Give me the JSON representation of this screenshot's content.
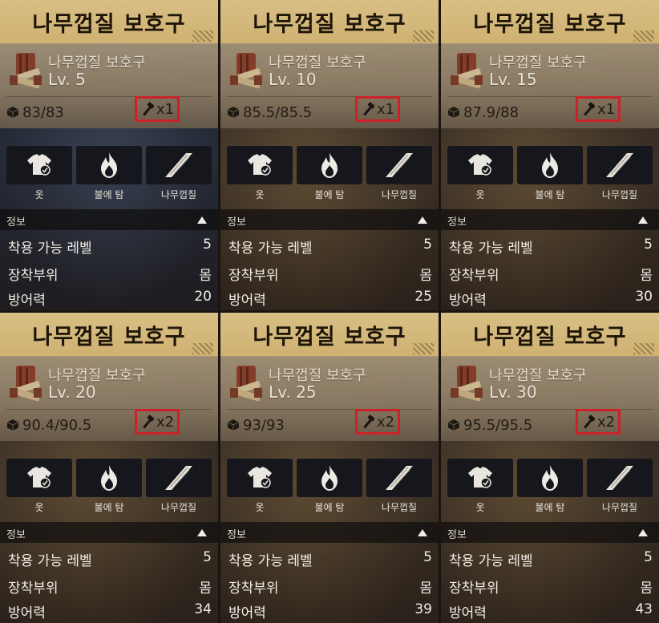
{
  "cards": [
    {
      "title": "나무껍질 보호구",
      "name": "나무껍질 보호구",
      "level": "Lv. 5",
      "durability": "83/83",
      "hammer": "x1",
      "tone": "blue",
      "buttons": [
        "옷",
        "불에 탐",
        "나무껍질"
      ],
      "section": "정보",
      "stats": [
        {
          "label": "착용 가능 레벨",
          "value": "5"
        },
        {
          "label": "장착부위",
          "value": "몸"
        },
        {
          "label": "방어력",
          "value": "20"
        }
      ]
    },
    {
      "title": "나무껍질 보호구",
      "name": "나무껍질 보호구",
      "level": "Lv. 10",
      "durability": "85.5/85.5",
      "hammer": "x1",
      "tone": "brown",
      "buttons": [
        "옷",
        "불에 탐",
        "나무껍질"
      ],
      "section": "정보",
      "stats": [
        {
          "label": "착용 가능 레벨",
          "value": "5"
        },
        {
          "label": "장착부위",
          "value": "몸"
        },
        {
          "label": "방어력",
          "value": "25"
        }
      ]
    },
    {
      "title": "나무껍질 보호구",
      "name": "나무껍질 보호구",
      "level": "Lv. 15",
      "durability": "87.9/88",
      "hammer": "x1",
      "tone": "brown",
      "buttons": [
        "옷",
        "불에 탐",
        "나무껍질"
      ],
      "section": "정보",
      "stats": [
        {
          "label": "착용 가능 레벨",
          "value": "5"
        },
        {
          "label": "장착부위",
          "value": "몸"
        },
        {
          "label": "방어력",
          "value": "30"
        }
      ]
    },
    {
      "title": "나무껍질 보호구",
      "name": "나무껍질 보호구",
      "level": "Lv. 20",
      "durability": "90.4/90.5",
      "hammer": "x2",
      "tone": "brown",
      "buttons": [
        "옷",
        "불에 탐",
        "나무껍질"
      ],
      "section": "정보",
      "stats": [
        {
          "label": "착용 가능 레벨",
          "value": "5"
        },
        {
          "label": "장착부위",
          "value": "몸"
        },
        {
          "label": "방어력",
          "value": "34"
        }
      ]
    },
    {
      "title": "나무껍질 보호구",
      "name": "나무껍질 보호구",
      "level": "Lv. 25",
      "durability": "93/93",
      "hammer": "x2",
      "tone": "brown",
      "buttons": [
        "옷",
        "불에 탐",
        "나무껍질"
      ],
      "section": "정보",
      "stats": [
        {
          "label": "착용 가능 레벨",
          "value": "5"
        },
        {
          "label": "장착부위",
          "value": "몸"
        },
        {
          "label": "방어력",
          "value": "39"
        }
      ]
    },
    {
      "title": "나무껍질 보호구",
      "name": "나무껍질 보호구",
      "level": "Lv. 30",
      "durability": "95.5/95.5",
      "hammer": "x2",
      "tone": "brown",
      "buttons": [
        "옷",
        "불에 탐",
        "나무껍질"
      ],
      "section": "정보",
      "stats": [
        {
          "label": "착용 가능 레벨",
          "value": "5"
        },
        {
          "label": "장착부위",
          "value": "몸"
        },
        {
          "label": "방어력",
          "value": "43"
        }
      ]
    }
  ],
  "colors": {
    "title_bar": "#d9bf85",
    "highlight": "#d8202a",
    "button_bg": "#15171c"
  }
}
